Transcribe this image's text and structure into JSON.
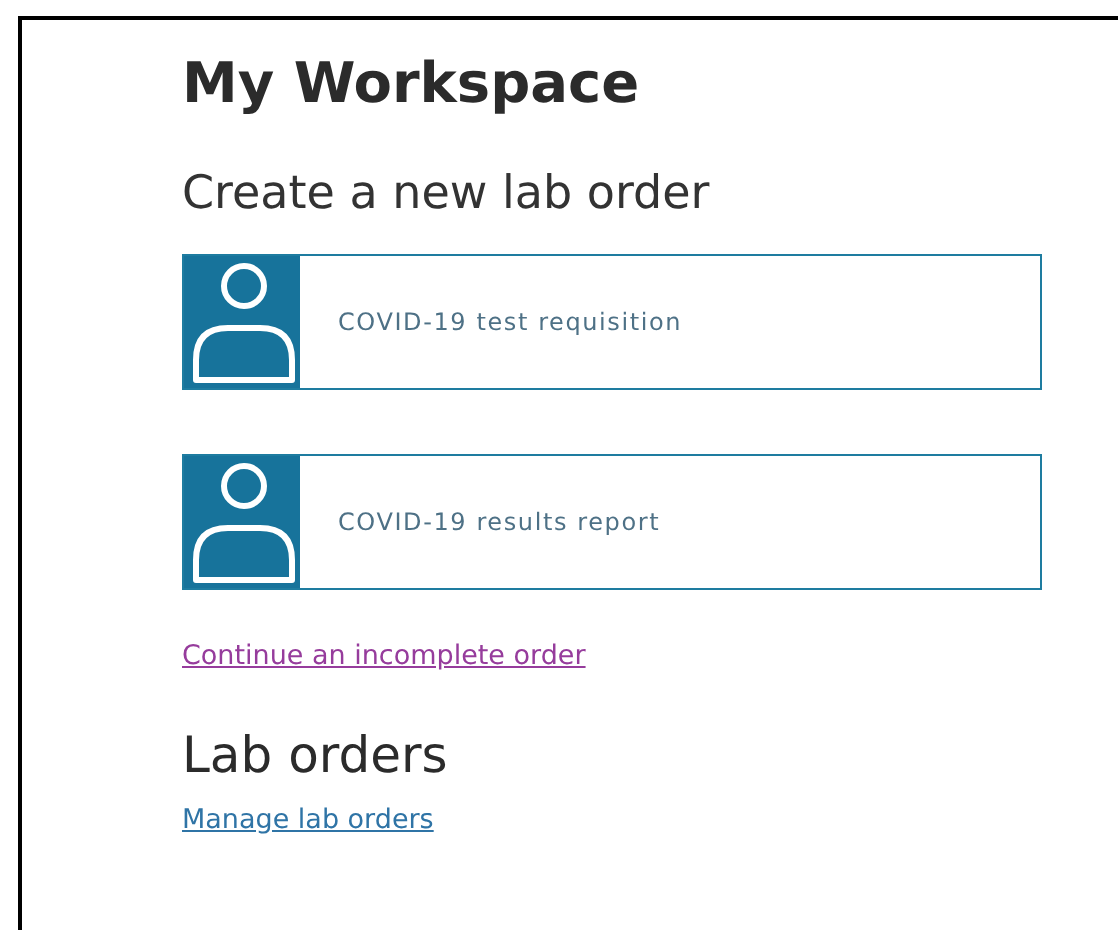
{
  "title": "My Workspace",
  "create_section": {
    "heading": "Create a new lab order",
    "cards": [
      {
        "label": "COVID-19 test requisition"
      },
      {
        "label": "COVID-19 results report"
      }
    ],
    "link": {
      "text": "Continue an incomplete order",
      "visited": true
    }
  },
  "orders_section": {
    "heading": "Lab orders",
    "link": {
      "text": "Manage lab orders",
      "visited": false
    }
  }
}
